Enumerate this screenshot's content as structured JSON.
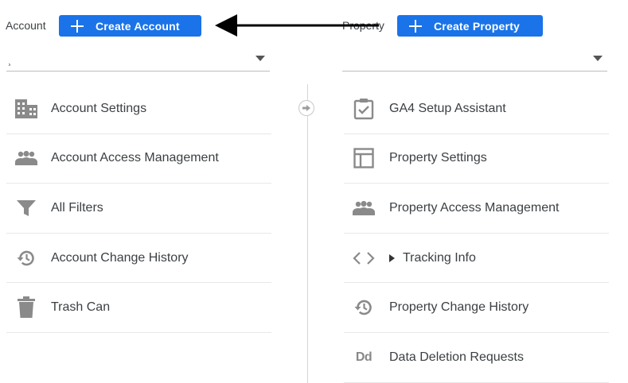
{
  "account": {
    "label": "Account",
    "create_button": "Create Account",
    "selector_value": "¸"
  },
  "property": {
    "label": "Property",
    "create_button": "Create Property",
    "selector_value": ""
  },
  "account_menu": [
    {
      "label": "Account Settings",
      "icon": "building-icon"
    },
    {
      "label": "Account Access Management",
      "icon": "people-icon"
    },
    {
      "label": "All Filters",
      "icon": "filter-icon"
    },
    {
      "label": "Account Change History",
      "icon": "history-icon"
    },
    {
      "label": "Trash Can",
      "icon": "trash-icon"
    }
  ],
  "property_menu": [
    {
      "label": "GA4 Setup Assistant",
      "icon": "checkbox-clipboard-icon"
    },
    {
      "label": "Property Settings",
      "icon": "layout-icon"
    },
    {
      "label": "Property Access Management",
      "icon": "people-icon"
    },
    {
      "label": "Tracking Info",
      "icon": "code-icon"
    },
    {
      "label": "Property Change History",
      "icon": "history-icon"
    },
    {
      "label": "Data Deletion Requests",
      "icon": "dd-icon",
      "icon_text": "Dd"
    }
  ],
  "colors": {
    "primary": "#1a73e8",
    "icon": "#8a8a8a",
    "annotation_arrow": "#000000"
  }
}
